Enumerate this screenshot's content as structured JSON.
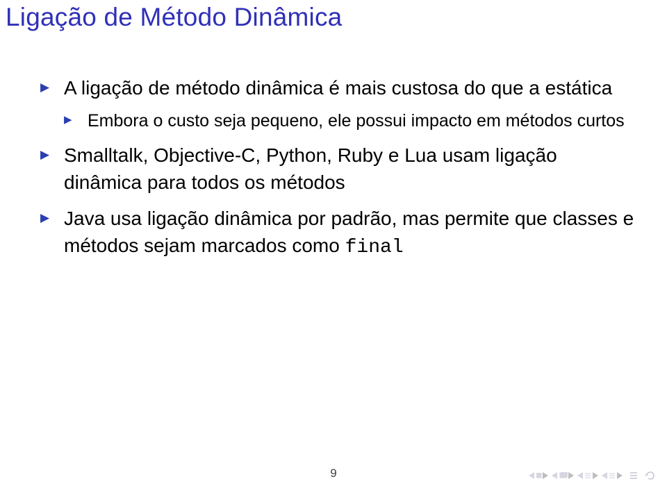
{
  "title": "Ligação de Método Dinâmica",
  "bullets": [
    {
      "text": "A ligação de método dinâmica é mais custosa do que a estática",
      "children": [
        {
          "text": "Embora o custo seja pequeno, ele possui impacto em métodos curtos"
        }
      ]
    },
    {
      "text": "Smalltalk, Objective-C, Python, Ruby e Lua usam ligação dinâmica para todos os métodos"
    },
    {
      "text_prefix": "Java usa ligação dinâmica por padrão, mas permite que classes e métodos sejam marcados como ",
      "code": "final"
    }
  ],
  "page_number": "9",
  "nav_icons": {
    "first": "first-slide-icon",
    "prev": "prev-slide-icon",
    "section_back": "section-back-icon",
    "section_fwd": "section-fwd-icon",
    "toc": "toc-icon",
    "refresh": "refresh-icon"
  }
}
